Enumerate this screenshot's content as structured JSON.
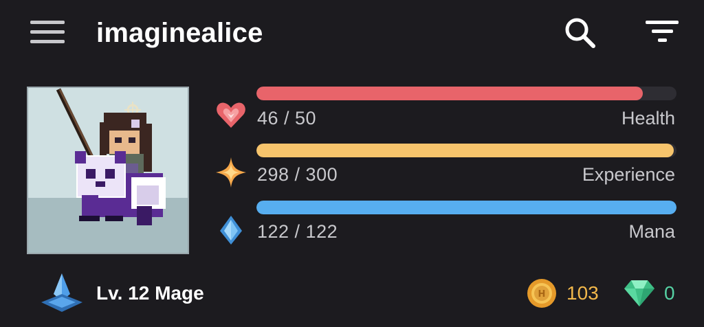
{
  "header": {
    "username": "imaginealice",
    "menu_icon": "hamburger-menu-icon",
    "search_icon": "search-icon",
    "filter_icon": "filter-icon"
  },
  "avatar": {
    "description_icon": "pixel-avatar"
  },
  "stats": [
    {
      "key": "health",
      "label": "Health",
      "value_text": "46 / 50",
      "current": 46,
      "max": 50,
      "color": "#e8646a",
      "icon": "heart-icon"
    },
    {
      "key": "experience",
      "label": "Experience",
      "value_text": "298 / 300",
      "current": 298,
      "max": 300,
      "color": "#f6c46c",
      "icon": "star-icon"
    },
    {
      "key": "mana",
      "label": "Mana",
      "value_text": "122 / 122",
      "current": 122,
      "max": 122,
      "color": "#57aef0",
      "icon": "droplet-icon"
    }
  ],
  "footer": {
    "level_text": "Lv. 12 Mage",
    "level_icon": "mage-class-icon",
    "gold": "103",
    "gold_icon": "gold-coin-icon",
    "gems": "0",
    "gem_icon": "gem-icon"
  },
  "colors": {
    "background": "#1c1b1f",
    "gold": "#f2b84b",
    "gem": "#56d2a4"
  }
}
